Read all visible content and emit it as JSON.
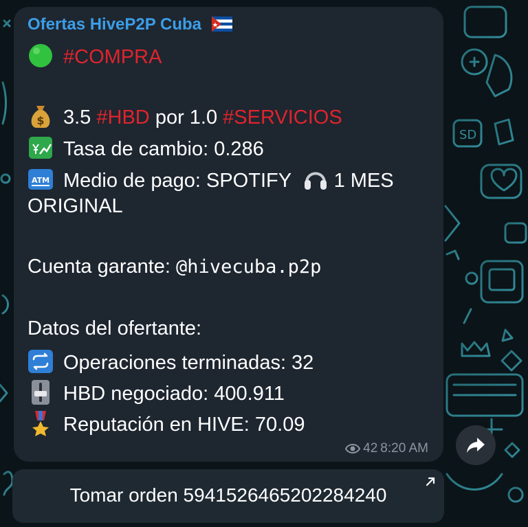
{
  "message": {
    "channel_name": "Ofertas HiveP2P Cuba",
    "type_tag": "#COMPRA",
    "amount": "3.5",
    "asset_tag": "#HBD",
    "por_text": "por 1.0",
    "category_tag": "#SERVICIOS",
    "exchange_rate": "Tasa de cambio: 0.286",
    "payment_method": "Medio de pago: SPOTIFY",
    "payment_detail_1": "1 MES",
    "payment_detail_2": "ORIGINAL",
    "escrow_label": "Cuenta garante:",
    "escrow_account": "@hivecuba.p2p",
    "offerer_heading": "Datos del ofertante:",
    "operations": "Operaciones terminadas: 32",
    "hbd_traded": "HBD negociado:  400.911",
    "reputation": "Reputación en HIVE: 70.09",
    "views": "42",
    "time": "8:20 AM"
  },
  "button": {
    "label": "Tomar orden 5941526465202284240"
  },
  "icons": {
    "type_dot": "green-circle-icon",
    "amount": "money-bag-icon",
    "rate": "chart-yen-icon",
    "payment": "atm-icon",
    "payment_extra": "headphones-icon",
    "operations": "repeat-icon",
    "hbd": "level-slider-icon",
    "reputation": "military-medal-icon",
    "flag": "cuba-flag-icon",
    "views": "eye-icon",
    "share": "share-arrow-icon",
    "open": "external-arrow-icon"
  },
  "colors": {
    "channel": "#3c9ee8",
    "hashtag": "#e0242c",
    "bubble": "#1e2630",
    "meta": "#8a96a2"
  }
}
